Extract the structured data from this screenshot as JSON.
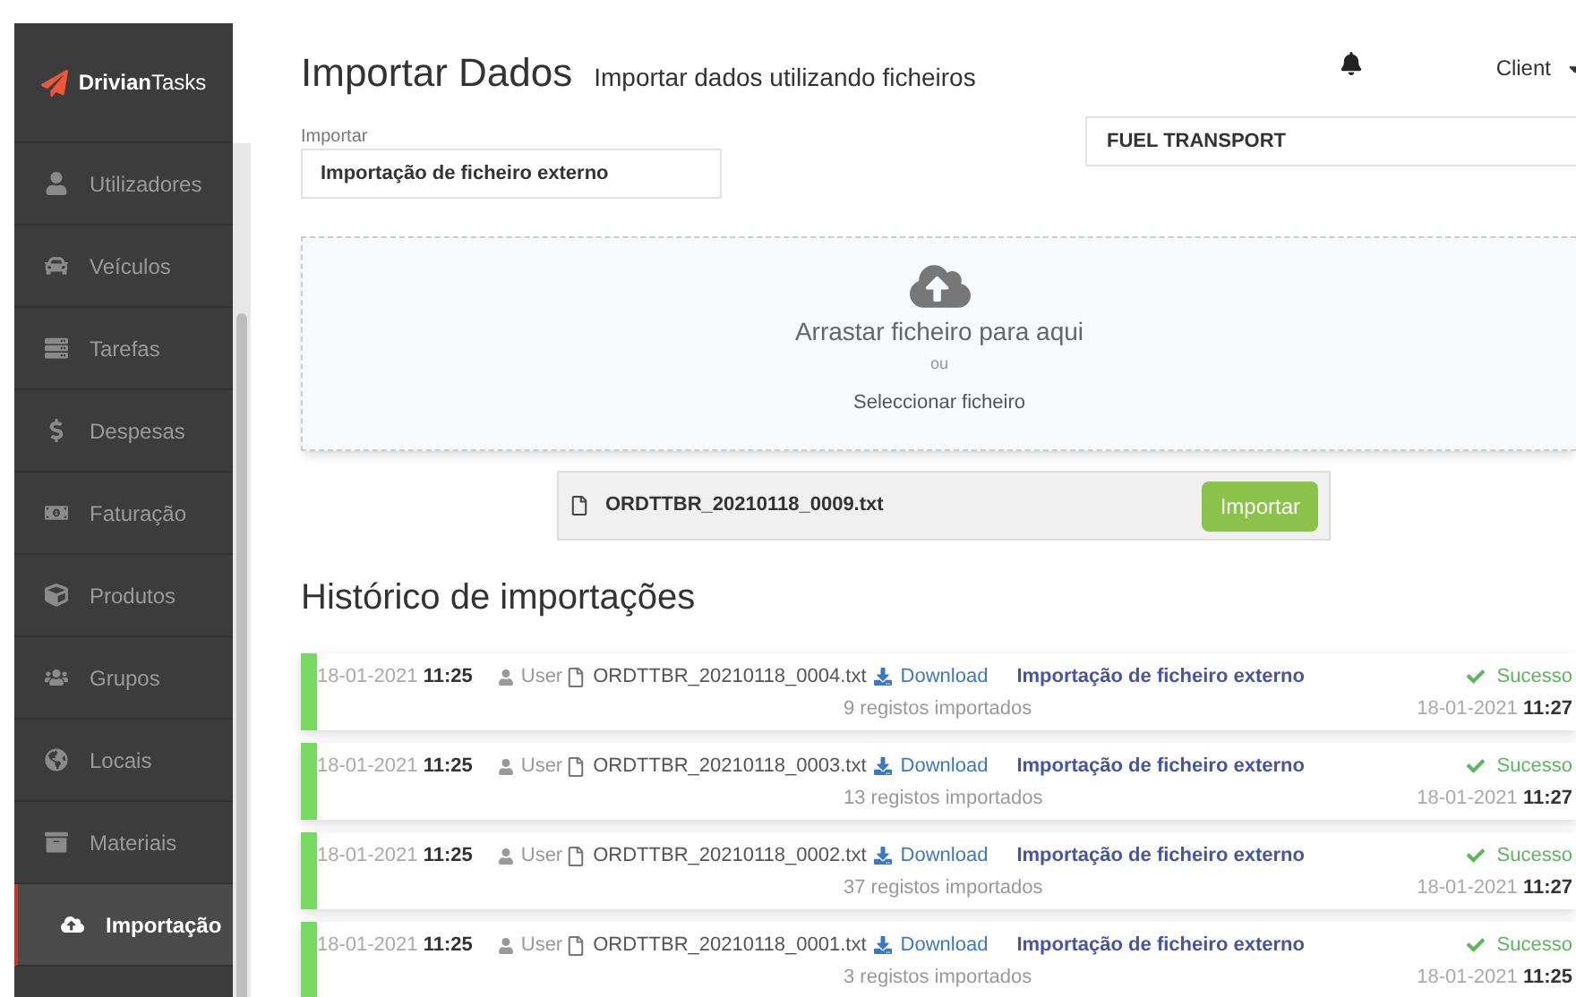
{
  "brand": {
    "bold": "Drivian",
    "light": "Tasks"
  },
  "sidebar": {
    "items": [
      {
        "label": "Utilizadores",
        "selected": false
      },
      {
        "label": "Veículos",
        "selected": false
      },
      {
        "label": "Tarefas",
        "selected": false
      },
      {
        "label": "Despesas",
        "selected": false
      },
      {
        "label": "Faturação",
        "selected": false
      },
      {
        "label": "Produtos",
        "selected": false
      },
      {
        "label": "Grupos",
        "selected": false
      },
      {
        "label": "Locais",
        "selected": false
      },
      {
        "label": "Materiais",
        "selected": false
      },
      {
        "label": "Importação",
        "selected": true
      }
    ]
  },
  "header": {
    "title": "Importar Dados",
    "subtitle": "Importar dados utilizando ficheiros",
    "user": "Client"
  },
  "import_field": {
    "label": "Importar",
    "value": "Importação de ficheiro externo"
  },
  "company_field": {
    "value": "FUEL TRANSPORT"
  },
  "dropzone": {
    "text": "Arrastar ficheiro para aqui",
    "or": "ou",
    "select": "Seleccionar ficheiro"
  },
  "selected_file": {
    "name": "ORDTTBR_20210118_0009.txt",
    "button": "Importar"
  },
  "history": {
    "title": "Histórico de importações",
    "rows": [
      {
        "date": "18-01-2021",
        "time": "11:25",
        "user": "User",
        "file": "ORDTTBR_20210118_0004.txt",
        "download": "Download",
        "type": "Importação de ficheiro externo",
        "records": "9 registos importados",
        "status": "Sucesso",
        "end_date": "18-01-2021",
        "end_time": "11:27",
        "color": "#77d862"
      },
      {
        "date": "18-01-2021",
        "time": "11:25",
        "user": "User",
        "file": "ORDTTBR_20210118_0003.txt",
        "download": "Download",
        "type": "Importação de ficheiro externo",
        "records": "13 registos importados",
        "status": "Sucesso",
        "end_date": "18-01-2021",
        "end_time": "11:27",
        "color": "#77d862"
      },
      {
        "date": "18-01-2021",
        "time": "11:25",
        "user": "User",
        "file": "ORDTTBR_20210118_0002.txt",
        "download": "Download",
        "type": "Importação de ficheiro externo",
        "records": "37 registos importados",
        "status": "Sucesso",
        "end_date": "18-01-2021",
        "end_time": "11:27",
        "color": "#77d862"
      },
      {
        "date": "18-01-2021",
        "time": "11:25",
        "user": "User",
        "file": "ORDTTBR_20210118_0001.txt",
        "download": "Download",
        "type": "Importação de ficheiro externo",
        "records": "3 registos importados",
        "status": "Sucesso",
        "end_date": "18-01-2021",
        "end_time": "11:25",
        "color": "#77d862"
      }
    ]
  }
}
